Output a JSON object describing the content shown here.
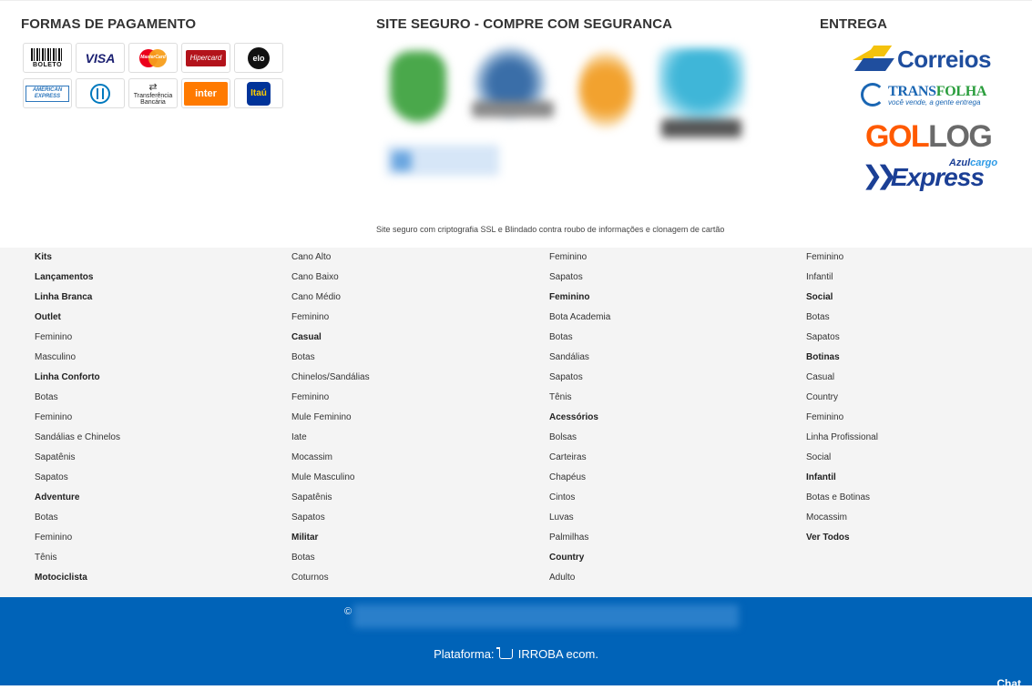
{
  "sections": {
    "payment_title": "FORMAS DE PAGAMENTO",
    "security_title": "SITE SEGURO - COMPRE COM SEGURANCA",
    "delivery_title": "ENTREGA",
    "security_note": "Site seguro com criptografia SSL e Blindado contra roubo de informações e clonagem de cartão"
  },
  "payment": {
    "boleto": "BOLETO",
    "visa": "VISA",
    "mastercard": "MasterCard",
    "hipercard": "Hipercard",
    "elo": "elo",
    "amex_1": "AMERICAN",
    "amex_2": "EXPRESS",
    "transfer_1": "Transferência",
    "transfer_2": "Bancária",
    "inter": "inter",
    "itau": "Itaú"
  },
  "delivery": {
    "correios": "Correios",
    "transfolha_a": "TRANS",
    "transfolha_b": "FOLHA",
    "transfolha_tag": "você vende, a gente entrega",
    "gollog_a": "GOL",
    "gollog_b": "LOG",
    "azul_a": "Azul",
    "azul_b": "cargo",
    "azul_main": "Express"
  },
  "categories": {
    "col0": [
      {
        "t": "Kits",
        "b": true
      },
      {
        "t": "Lançamentos",
        "b": true
      },
      {
        "t": "Linha Branca",
        "b": true
      },
      {
        "t": "Outlet",
        "b": true
      },
      {
        "t": "Feminino",
        "b": false
      },
      {
        "t": "Masculino",
        "b": false
      },
      {
        "t": "Linha Conforto",
        "b": true
      },
      {
        "t": "Botas",
        "b": false
      },
      {
        "t": "Feminino",
        "b": false
      },
      {
        "t": "Sandálias e Chinelos",
        "b": false
      },
      {
        "t": "Sapatênis",
        "b": false
      },
      {
        "t": "Sapatos",
        "b": false
      },
      {
        "t": "Adventure",
        "b": true
      },
      {
        "t": "Botas",
        "b": false
      },
      {
        "t": "Feminino",
        "b": false
      },
      {
        "t": "Tênis",
        "b": false
      },
      {
        "t": "Motociclista",
        "b": true
      }
    ],
    "col1": [
      {
        "t": "Cano Alto",
        "b": false
      },
      {
        "t": "Cano Baixo",
        "b": false
      },
      {
        "t": "Cano Médio",
        "b": false
      },
      {
        "t": "Feminino",
        "b": false
      },
      {
        "t": "Casual",
        "b": true
      },
      {
        "t": "Botas",
        "b": false
      },
      {
        "t": "Chinelos/Sandálias",
        "b": false
      },
      {
        "t": "Feminino",
        "b": false
      },
      {
        "t": "Mule Feminino",
        "b": false
      },
      {
        "t": "Iate",
        "b": false
      },
      {
        "t": "Mocassim",
        "b": false
      },
      {
        "t": "Mule Masculino",
        "b": false
      },
      {
        "t": "Sapatênis",
        "b": false
      },
      {
        "t": "Sapatos",
        "b": false
      },
      {
        "t": "Militar",
        "b": true
      },
      {
        "t": "Botas",
        "b": false
      },
      {
        "t": "Coturnos",
        "b": false
      }
    ],
    "col2": [
      {
        "t": "Feminino",
        "b": false
      },
      {
        "t": "Sapatos",
        "b": false
      },
      {
        "t": "Feminino",
        "b": true
      },
      {
        "t": "Bota Academia",
        "b": false
      },
      {
        "t": "Botas",
        "b": false
      },
      {
        "t": "Sandálias",
        "b": false
      },
      {
        "t": "Sapatos",
        "b": false
      },
      {
        "t": "Tênis",
        "b": false
      },
      {
        "t": "Acessórios",
        "b": true
      },
      {
        "t": "Bolsas",
        "b": false
      },
      {
        "t": "Carteiras",
        "b": false
      },
      {
        "t": "Chapéus",
        "b": false
      },
      {
        "t": "Cintos",
        "b": false
      },
      {
        "t": "Luvas",
        "b": false
      },
      {
        "t": "Palmilhas",
        "b": false
      },
      {
        "t": "Country",
        "b": true
      },
      {
        "t": "Adulto",
        "b": false
      }
    ],
    "col3": [
      {
        "t": "Feminino",
        "b": false
      },
      {
        "t": "Infantil",
        "b": false
      },
      {
        "t": "Social",
        "b": true
      },
      {
        "t": "Botas",
        "b": false
      },
      {
        "t": "Sapatos",
        "b": false
      },
      {
        "t": "Botinas",
        "b": true
      },
      {
        "t": "Casual",
        "b": false
      },
      {
        "t": "Country",
        "b": false
      },
      {
        "t": "Feminino",
        "b": false
      },
      {
        "t": "Linha Profissional",
        "b": false
      },
      {
        "t": "Social",
        "b": false
      },
      {
        "t": "Infantil",
        "b": true
      },
      {
        "t": "Botas e Botinas",
        "b": false
      },
      {
        "t": "Mocassim",
        "b": false
      },
      {
        "t": "Ver Todos",
        "b": true
      }
    ]
  },
  "footer": {
    "copyright_symbol": "©",
    "platform_label": "Plataforma:",
    "platform_name": "IRROBA ecom.",
    "chat_label": "Chat"
  }
}
